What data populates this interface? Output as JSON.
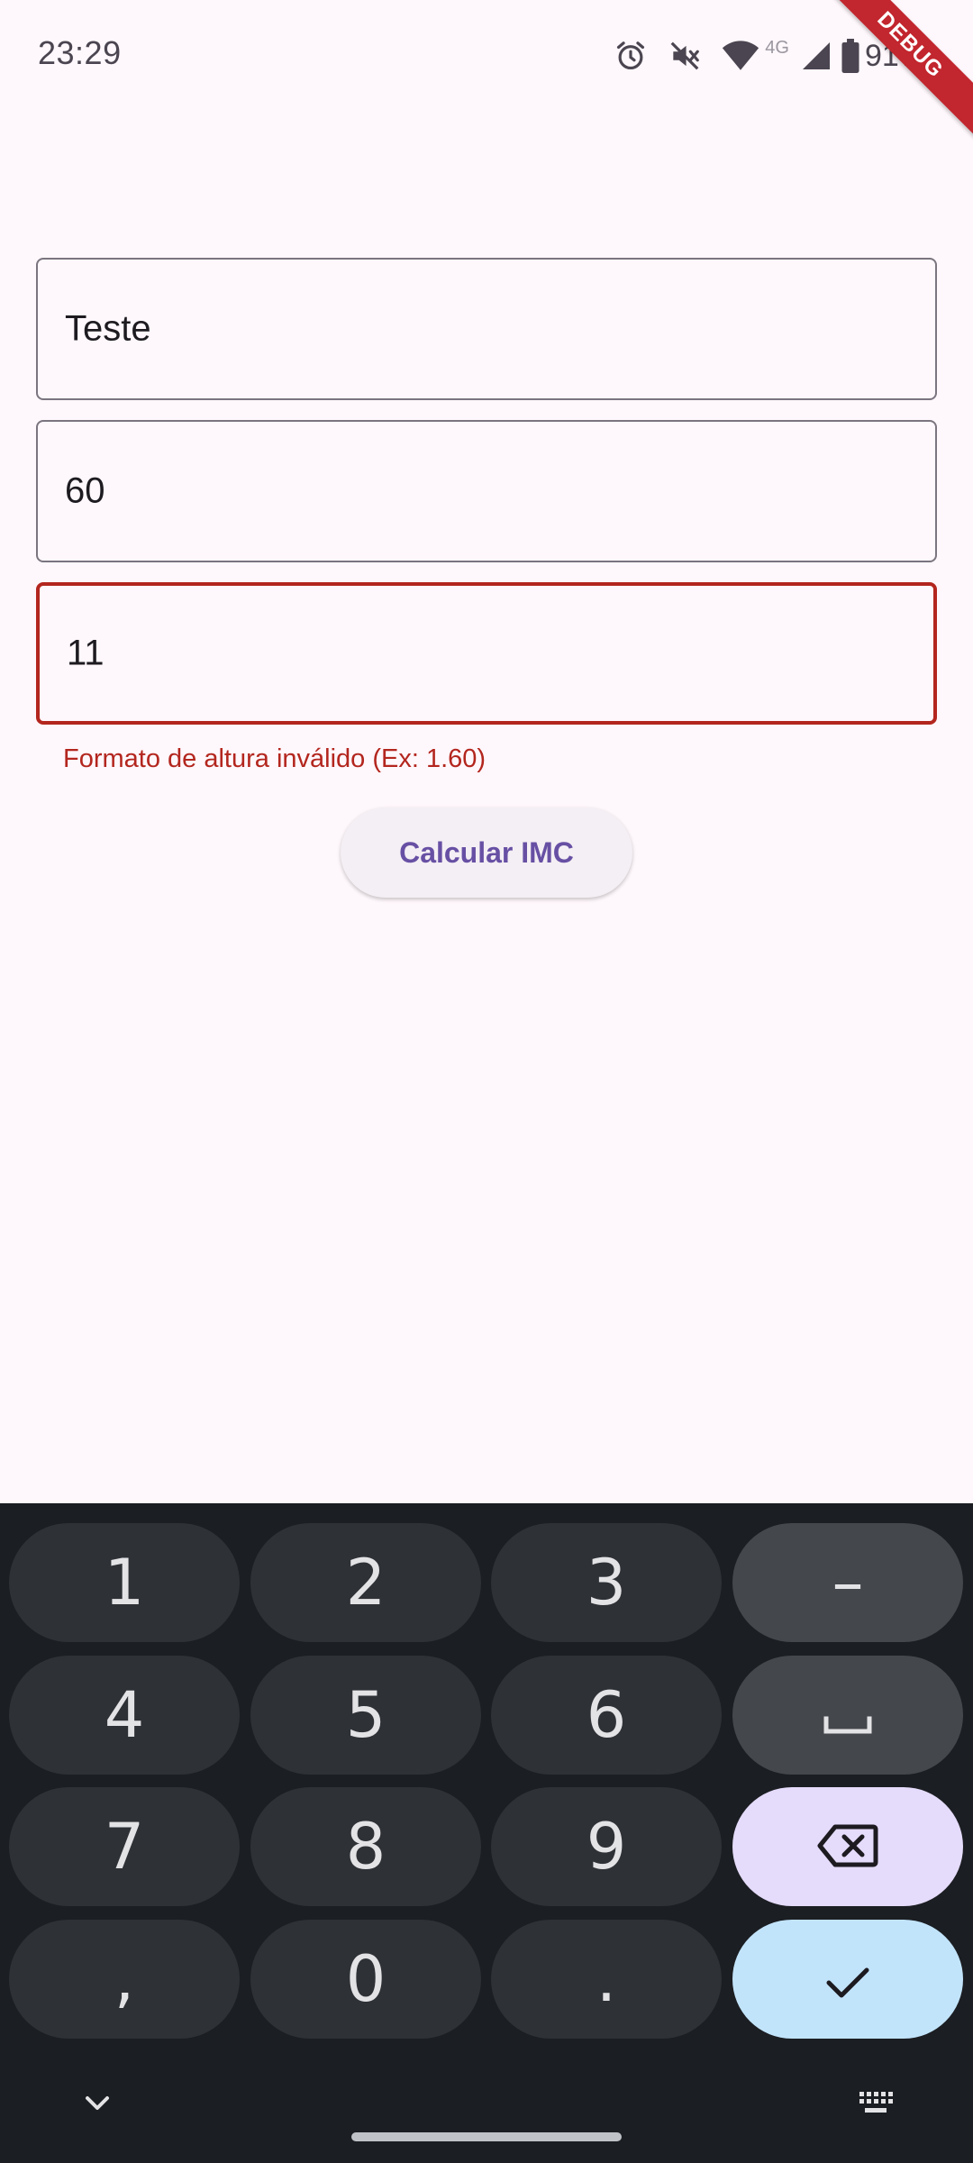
{
  "status_bar": {
    "time": "23:29",
    "network_label": "4G",
    "battery_text": "91%",
    "icons": [
      "alarm-icon",
      "mute-icon",
      "wifi-icon",
      "cell-signal-icon",
      "battery-icon"
    ]
  },
  "debug_banner": "DEBUG",
  "form": {
    "name_value": "Teste",
    "weight_value": "60",
    "height_value": "11",
    "height_error": "Formato de altura inválido (Ex: 1.60)",
    "calculate_label": "Calcular IMC"
  },
  "keyboard": {
    "keys": {
      "k1": "1",
      "k2": "2",
      "k3": "3",
      "minus": "–",
      "k4": "4",
      "k5": "5",
      "k6": "6",
      "k7": "7",
      "k8": "8",
      "k9": "9",
      "comma": ",",
      "k0": "0",
      "period": "."
    },
    "icons": [
      "space-icon",
      "backspace-icon",
      "check-icon",
      "chevron-down-icon",
      "keyboard-icon"
    ]
  },
  "colors": {
    "background": "#fef7fb",
    "error": "#b3261e",
    "primary": "#6750a4",
    "keyboard_bg": "#1b1e22",
    "key_bg": "#2e3135",
    "backspace_bg": "#e5dbfb",
    "enter_bg": "#c2e4fb"
  }
}
